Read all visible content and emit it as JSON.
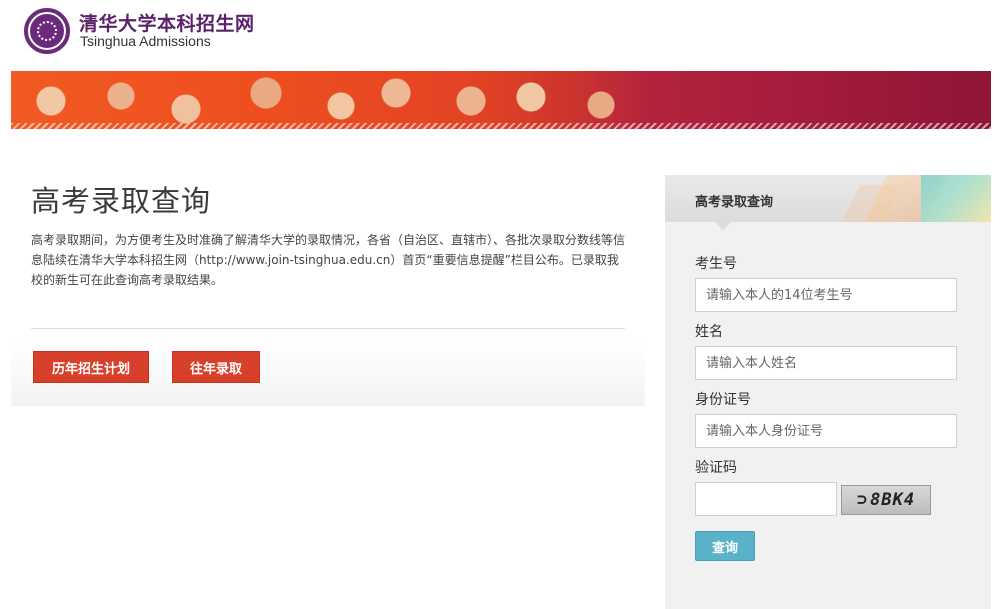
{
  "header": {
    "logo_cn": "清华大学本科招生网",
    "logo_en": "Tsinghua Admissions"
  },
  "main": {
    "title": "高考录取查询",
    "intro": "高考录取期间，为方便考生及时准确了解清华大学的录取情况，各省（自治区、直辖市）、各批次录取分数线等信息陆续在清华大学本科招生网（http://www.join-tsinghua.edu.cn）首页“重要信息提醒”栏目公布。已录取我校的新生可在此查询高考录取结果。",
    "buttons": {
      "plan": "历年招生计划",
      "past": "往年录取"
    }
  },
  "form": {
    "panel_title": "高考录取查询",
    "exam_no_label": "考生号",
    "exam_no_placeholder": "请输入本人的14位考生号",
    "name_label": "姓名",
    "name_placeholder": "请输入本人姓名",
    "id_label": "身份证号",
    "id_placeholder": "请输入本人身份证号",
    "captcha_label": "验证码",
    "captcha_text": "8BK4",
    "submit": "查询"
  },
  "colors": {
    "brand_purple": "#5a2368",
    "button_red": "#d9402c",
    "button_blue": "#5ab2c9"
  }
}
